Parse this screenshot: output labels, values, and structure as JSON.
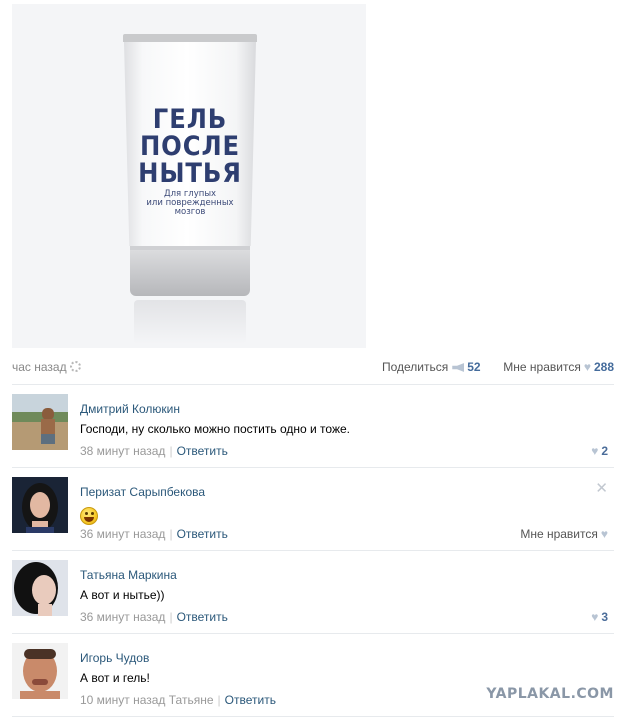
{
  "post": {
    "product": {
      "title_lines": [
        "ГЕЛЬ",
        "ПОСЛЕ",
        "НЫТЬЯ"
      ],
      "subtitle_lines": [
        "Для глупых",
        "или поврежденных",
        "мозгов"
      ]
    },
    "time": "час назад",
    "share_label": "Поделиться",
    "share_count": "52",
    "like_label": "Мне нравится",
    "like_count": "288"
  },
  "comments": [
    {
      "name": "Дмитрий Колюкин",
      "text": "Господи, ну сколько можно постить одно и тоже.",
      "time": "38 минут назад",
      "reply": "Ответить",
      "likes": "2"
    },
    {
      "name": "Перизат Сарыпбекова",
      "text": "",
      "emoji": "smile",
      "time": "36 минут назад",
      "reply": "Ответить",
      "like_label": "Мне нравится",
      "close": "✕"
    },
    {
      "name": "Татьяна Маркина",
      "text": "А вот и нытье))",
      "time": "36 минут назад",
      "reply": "Ответить",
      "likes": "3"
    },
    {
      "name": "Игорь Чудов",
      "text": "А вот и гель!",
      "time": "10 минут назад Татьяне",
      "reply": "Ответить"
    }
  ],
  "watermark": "YAPLAKAL.COM",
  "colors": {
    "link": "#2b587a",
    "count": "#456c9c",
    "divider": "#e7eaed"
  }
}
